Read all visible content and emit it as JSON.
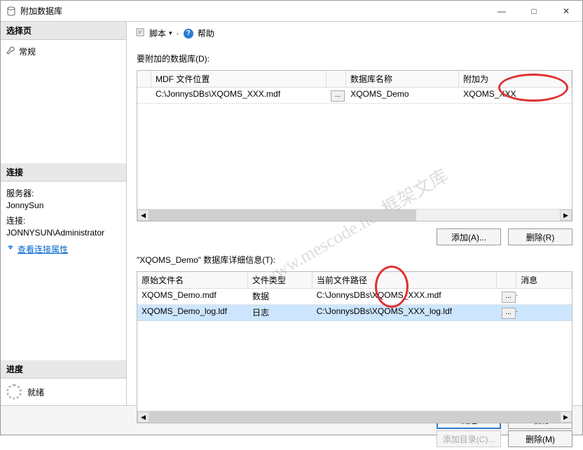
{
  "window": {
    "title": "附加数据库"
  },
  "winbtn": {
    "min": "—",
    "max": "□",
    "close": "✕"
  },
  "sidebar": {
    "select_hdr": "选择页",
    "general": "常规",
    "conn_hdr": "连接",
    "server_lbl": "服务器:",
    "server_val": "JonnySun",
    "conn_lbl": "连接:",
    "conn_val": "JONNYSUN\\Administrator",
    "view_link": "查看连接属性",
    "progress_hdr": "进度",
    "ready": "就绪"
  },
  "toolbar": {
    "script": "脚本",
    "dropdown": "▾",
    "help": "帮助"
  },
  "section1": {
    "label": "要附加的数据库(D):",
    "hdr_mdf": "MDF 文件位置",
    "hdr_dbname": "数据库名称",
    "hdr_attach": "附加为",
    "row_path": "C:\\JonnysDBs\\XQOMS_XXX.mdf",
    "row_dbname": "XQOMS_Demo",
    "row_attach": "XQOMS_XXX",
    "btn_add": "添加(A)...",
    "btn_del": "删除(R)"
  },
  "section2": {
    "label": "\"XQOMS_Demo\" 数据库详细信息(T):",
    "hdr_orig": "原始文件名",
    "hdr_type": "文件类型",
    "hdr_path": "当前文件路径",
    "hdr_msg": "消息",
    "r1_name": "XQOMS_Demo.mdf",
    "r1_type": "数据",
    "r1_path": "C:\\JonnysDBs\\XQOMS_XXX.mdf",
    "r2_name": "XQOMS_Demo_log.ldf",
    "r2_type": "日志",
    "r2_path": "C:\\JonnysDBs\\XQOMS_XXX_log.ldf",
    "btn_add": "添加目录(C)...",
    "btn_del": "删除(M)"
  },
  "footer": {
    "ok": "确定",
    "cancel": "取消"
  },
  "watermark": "www.mescode.net 框架文库"
}
